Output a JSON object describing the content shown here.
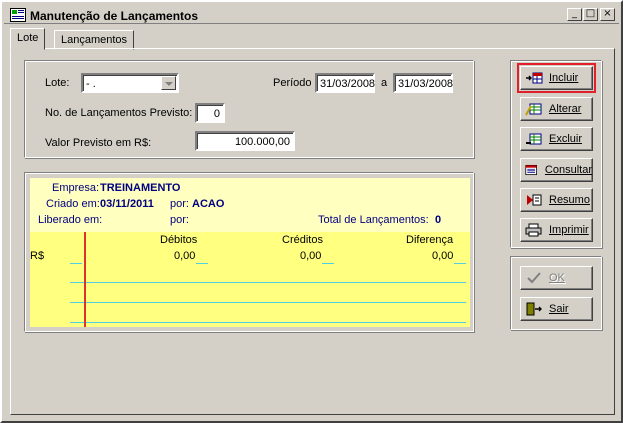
{
  "window": {
    "title": "Manutenção de Lançamentos",
    "controls": [
      "_",
      "□",
      "×"
    ]
  },
  "tabs": [
    {
      "label": "Lote",
      "active": true
    },
    {
      "label": "Lançamentos",
      "active": false
    }
  ],
  "form": {
    "lote_label": "Lote:",
    "lote_value": "- .",
    "periodo_label": "Período",
    "periodo_from": "31/03/2008",
    "periodo_sep": "a",
    "periodo_to": "31/03/2008",
    "num_lanc_label": "No. de Lançamentos Previsto:",
    "num_lanc_value": "0",
    "valor_label": "Valor Previsto em  R$:",
    "valor_value": "100.000,00"
  },
  "summary": {
    "empresa_label": "Empresa:",
    "empresa_value": "TREINAMENTO",
    "criado_label": "Criado em:",
    "criado_value": "03/11/2011",
    "criado_por_label": "por:",
    "criado_por_value": "ACAO",
    "liberado_label": "Liberado em:",
    "liberado_por_label": "por:",
    "total_label": "Total de Lançamentos:",
    "total_value": "0",
    "columns": [
      "Débitos",
      "Créditos",
      "Diferença"
    ],
    "row_label": "R$",
    "row_values": [
      "0,00",
      "0,00",
      "0,00"
    ]
  },
  "buttons": {
    "incluir": "Incluir",
    "alterar": "Alterar",
    "excluir": "Excluir",
    "consultar": "Consultar",
    "resumo": "Resumo",
    "imprimir": "Imprimir",
    "ok": "OK",
    "sair": "Sair"
  },
  "colors": {
    "panel_bg": "#ffffc0",
    "grid_bg": "#ffff80",
    "accent_red": "#e0202a",
    "label_blue": "#000080"
  }
}
